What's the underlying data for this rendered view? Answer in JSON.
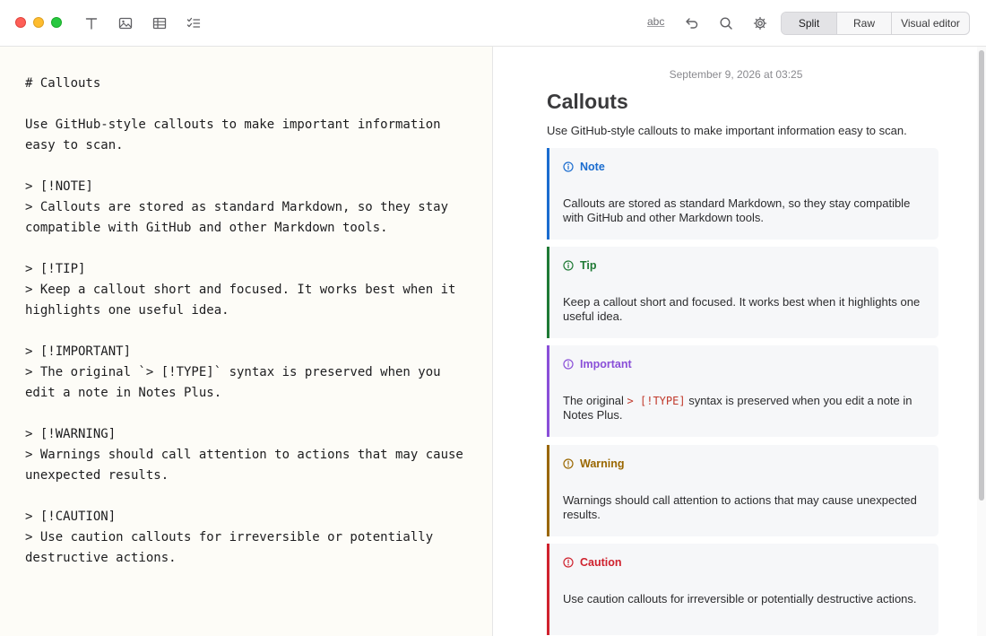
{
  "toolbar": {
    "spellcheck_label": "abc",
    "view_modes": [
      "Split",
      "Raw",
      "Visual editor"
    ],
    "selected_view": "Split",
    "icons": [
      "text-format-icon",
      "image-icon",
      "table-icon",
      "checklist-icon",
      "undo-icon",
      "search-icon",
      "gear-icon"
    ]
  },
  "editor": {
    "markdown": "# Callouts\n\nUse GitHub-style callouts to make important information\neasy to scan.\n\n> [!NOTE]\n> Callouts are stored as standard Markdown, so they stay\ncompatible with GitHub and other Markdown tools.\n\n> [!TIP]\n> Keep a callout short and focused. It works best when it\nhighlights one useful idea.\n\n> [!IMPORTANT]\n> The original `> [!TYPE]` syntax is preserved when you\nedit a note in Notes Plus.\n\n> [!WARNING]\n> Warnings should call attention to actions that may cause\nunexpected results.\n\n> [!CAUTION]\n> Use caution callouts for irreversible or potentially\ndestructive actions."
  },
  "preview": {
    "date": "September 9, 2026 at 03:25",
    "title": "Callouts",
    "intro": "Use GitHub-style callouts to make important information easy to scan.",
    "callouts": [
      {
        "type": "Note",
        "text": "Callouts are stored as standard Markdown, so they stay compatible with GitHub and other Markdown tools.",
        "color": "#1a6ccf"
      },
      {
        "type": "Tip",
        "text": "Keep a callout short and focused. It works best when it highlights one useful idea.",
        "color": "#1f7a35"
      },
      {
        "type": "Important",
        "text_before": "The original ",
        "code": "> [!TYPE]",
        "text_after": " syntax is preserved when you edit a note in Notes Plus.",
        "color": "#8a4fd8"
      },
      {
        "type": "Warning",
        "text": "Warnings should call attention to actions that may cause unexpected results.",
        "color": "#9a6700"
      },
      {
        "type": "Caution",
        "text": "Use caution callouts for irreversible or potentially destructive actions.",
        "color": "#cf222e"
      }
    ]
  },
  "colors": {
    "editor_background": "#fdfcf7",
    "callout_background": "#f6f7f9"
  }
}
